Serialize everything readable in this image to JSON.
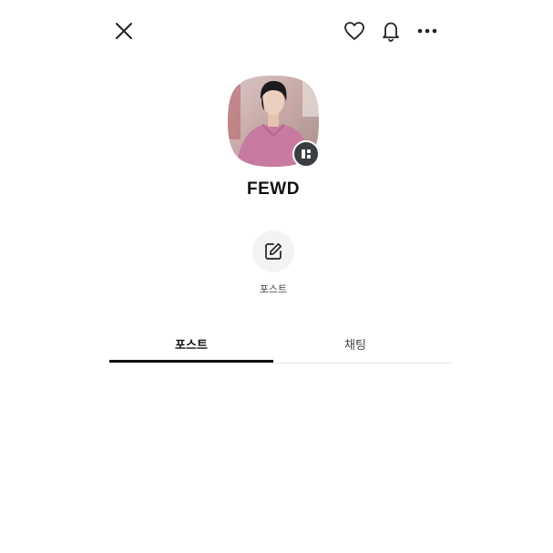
{
  "header": {
    "icons": [
      "close-icon",
      "heart-icon",
      "bell-icon",
      "more-icon"
    ]
  },
  "profile": {
    "name": "FEWD",
    "avatar_icon": "profile-photo",
    "badge_icon": "channel-badge-icon"
  },
  "actions": {
    "post_label": "포스트",
    "post_icon": "edit-icon"
  },
  "tabs": [
    {
      "label": "포스트",
      "active": true
    },
    {
      "label": "채팅",
      "active": false
    }
  ],
  "colors": {
    "text": "#111111",
    "muted": "#444444",
    "badge": "#3a3d42",
    "action_bg": "#f3f3f3",
    "avatar_shirt": "#c87aa0"
  }
}
